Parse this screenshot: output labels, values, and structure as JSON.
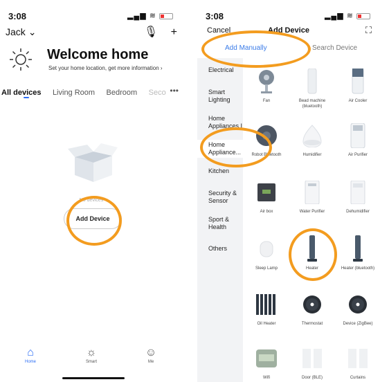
{
  "left": {
    "status_time": "3:08",
    "home_name": "Jack",
    "welcome_title": "Welcome home",
    "welcome_subtitle": "Set your home location, get more information",
    "tabs": [
      "All devices",
      "Living Room",
      "Bedroom",
      "Seco"
    ],
    "tab_more": "•••",
    "empty_text": "No devices",
    "add_device_label": "Add Device",
    "tabbar": [
      {
        "label": "Home",
        "icon": "home-icon"
      },
      {
        "label": "Smart",
        "icon": "smart-icon"
      },
      {
        "label": "Me",
        "icon": "me-icon"
      }
    ]
  },
  "right": {
    "status_time": "3:08",
    "cancel_label": "Cancel",
    "title": "Add Device",
    "subtabs": {
      "manual": "Add Manually",
      "search": "Search Device"
    },
    "categories": [
      "Electrical",
      "Smart Lighting",
      "Home Appliances I",
      "Home Appliance...",
      "Kitchen",
      "Security & Sensor",
      "Sport & Health",
      "Others"
    ],
    "devices": [
      {
        "label": "Fan"
      },
      {
        "label": "Bead machine (bluetooth)"
      },
      {
        "label": "Air Cooler"
      },
      {
        "label": "Robot Bluetooth"
      },
      {
        "label": "Humidifier"
      },
      {
        "label": "Air Purifier"
      },
      {
        "label": "Air box"
      },
      {
        "label": "Water Purifier"
      },
      {
        "label": "Dehumidifier"
      },
      {
        "label": "Sleep Lamp"
      },
      {
        "label": "Heater"
      },
      {
        "label": "Heater (bluetooth)"
      },
      {
        "label": "Oil Heater"
      },
      {
        "label": "Thermostat"
      },
      {
        "label": "Device (ZigBee)"
      },
      {
        "label": "Wifi"
      },
      {
        "label": "Door (BLE)"
      },
      {
        "label": "Curtains"
      }
    ]
  },
  "colors": {
    "accent": "#2b6df5",
    "highlight": "#f39c1f"
  }
}
